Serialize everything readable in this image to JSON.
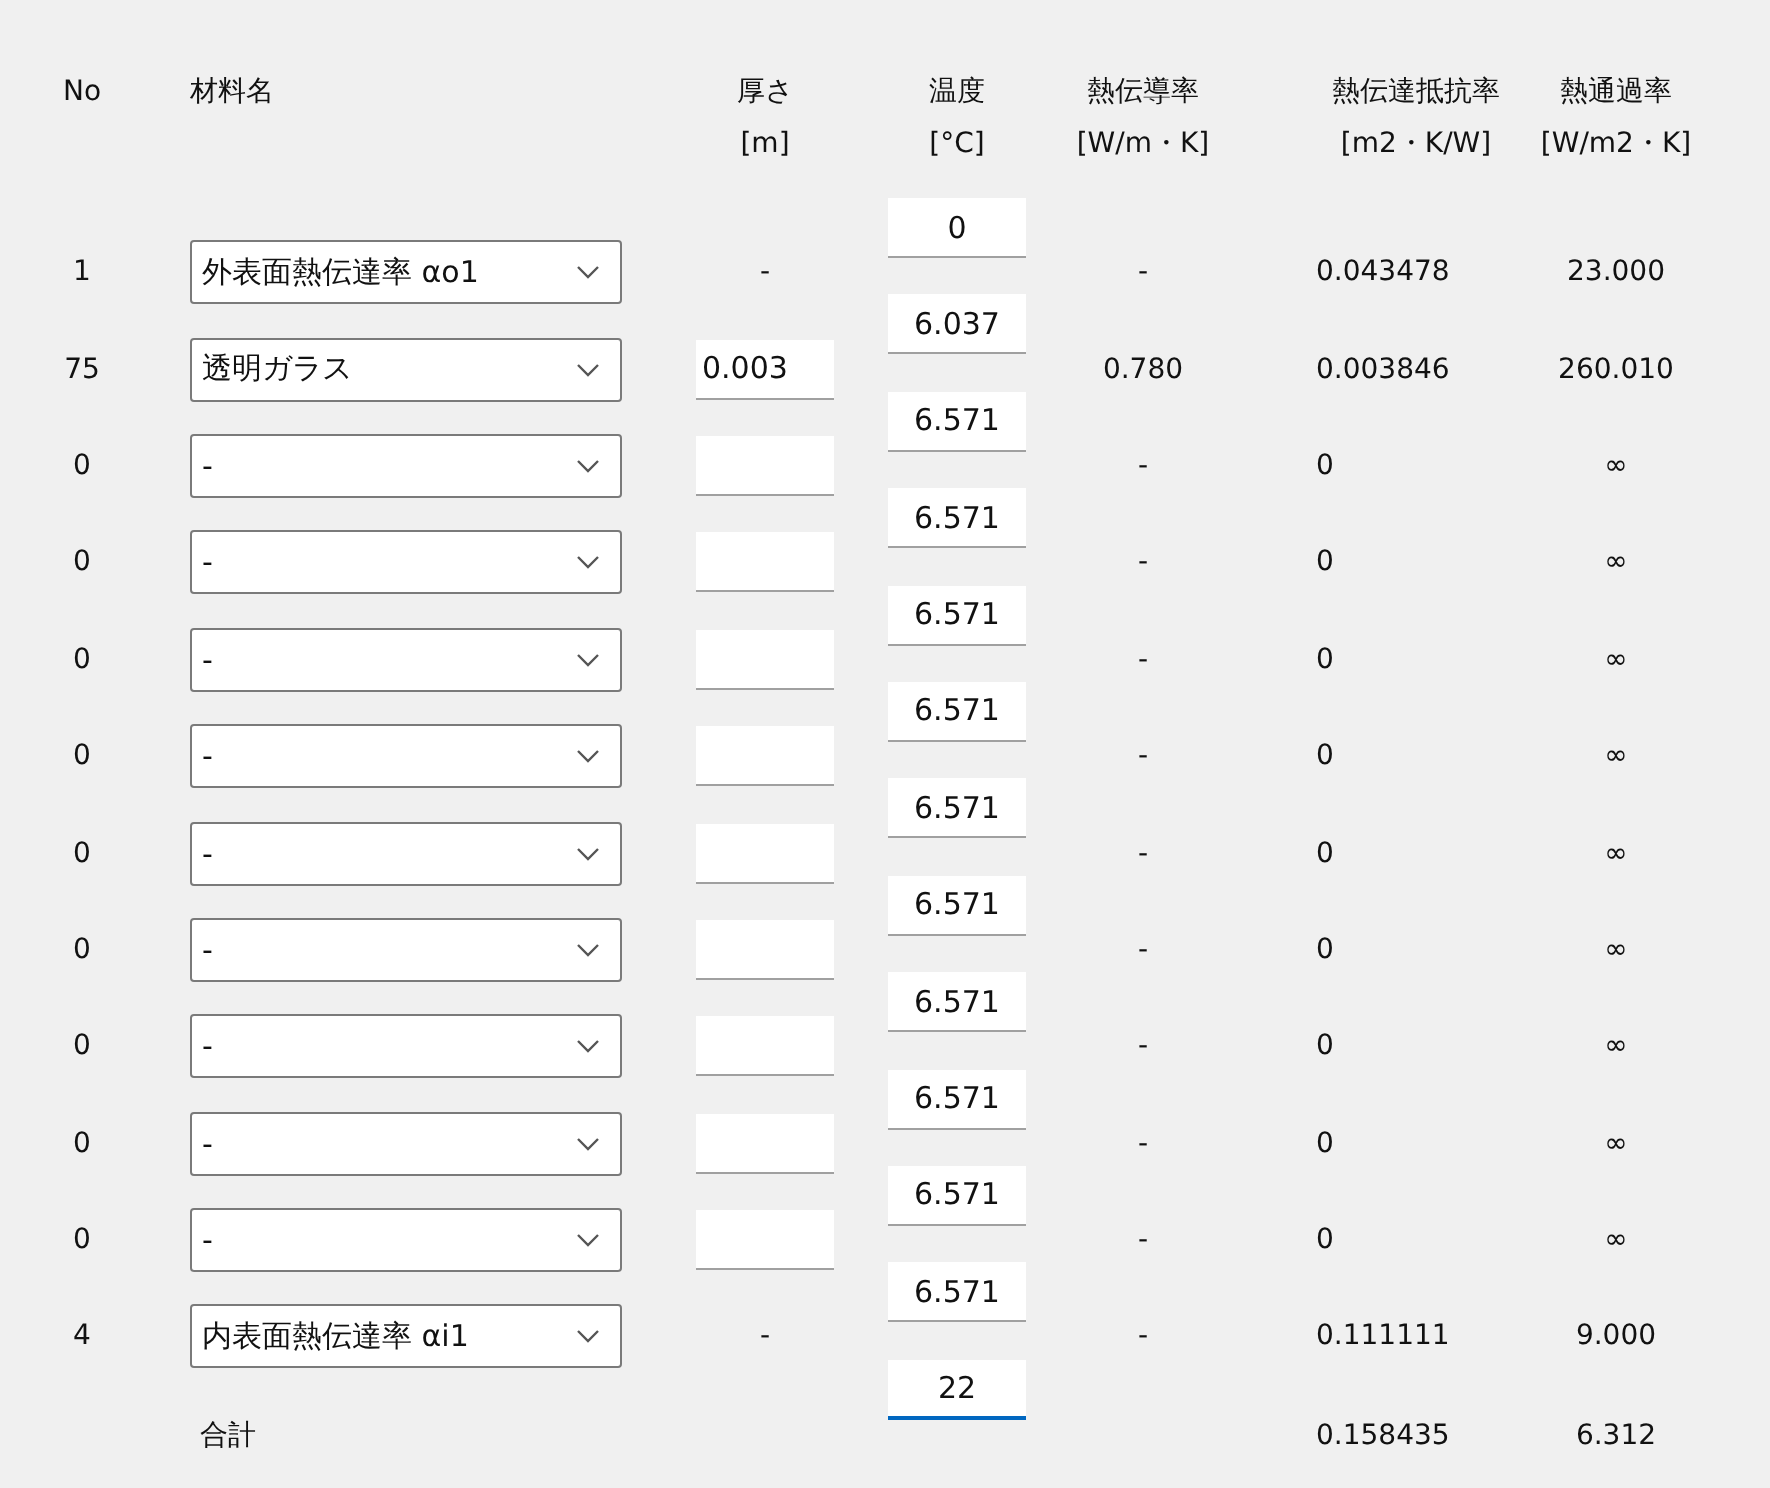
{
  "header": {
    "no": "No",
    "material": "材料名",
    "thickness": [
      "厚さ",
      "[m]"
    ],
    "temperature": [
      "温度",
      "[°C]"
    ],
    "conductivity": [
      "熱伝導率",
      "[W/m・K]"
    ],
    "resistance": [
      "熱伝達抵抗率",
      "[m2・K/W]"
    ],
    "transmittance": [
      "熱通過率",
      "[W/m2・K]"
    ]
  },
  "layers": [
    {
      "no": "1",
      "material": "外表面熱伝達率 αo1",
      "thickness": {
        "kind": "text",
        "value": "-"
      },
      "conductivity": "-",
      "resistance": "0.043478",
      "transmittance": "23.000"
    },
    {
      "no": "75",
      "material": "透明ガラス",
      "thickness": {
        "kind": "input",
        "value": "0.003"
      },
      "conductivity": "0.780",
      "resistance": "0.003846",
      "transmittance": "260.010"
    },
    {
      "no": "0",
      "material": "-",
      "thickness": {
        "kind": "input"
      },
      "conductivity": "-",
      "resistance": "0",
      "transmittance": "∞"
    },
    {
      "no": "0",
      "material": "-",
      "thickness": {
        "kind": "input"
      },
      "conductivity": "-",
      "resistance": "0",
      "transmittance": "∞"
    },
    {
      "no": "0",
      "material": "-",
      "thickness": {
        "kind": "input"
      },
      "conductivity": "-",
      "resistance": "0",
      "transmittance": "∞"
    },
    {
      "no": "0",
      "material": "-",
      "thickness": {
        "kind": "input"
      },
      "conductivity": "-",
      "resistance": "0",
      "transmittance": "∞"
    },
    {
      "no": "0",
      "material": "-",
      "thickness": {
        "kind": "input"
      },
      "conductivity": "-",
      "resistance": "0",
      "transmittance": "∞"
    },
    {
      "no": "0",
      "material": "-",
      "thickness": {
        "kind": "input"
      },
      "conductivity": "-",
      "resistance": "0",
      "transmittance": "∞"
    },
    {
      "no": "0",
      "material": "-",
      "thickness": {
        "kind": "input"
      },
      "conductivity": "-",
      "resistance": "0",
      "transmittance": "∞"
    },
    {
      "no": "0",
      "material": "-",
      "thickness": {
        "kind": "input"
      },
      "conductivity": "-",
      "resistance": "0",
      "transmittance": "∞"
    },
    {
      "no": "0",
      "material": "-",
      "thickness": {
        "kind": "input"
      },
      "conductivity": "-",
      "resistance": "0",
      "transmittance": "∞"
    },
    {
      "no": "4",
      "material": "内表面熱伝達率 αi1",
      "thickness": {
        "kind": "text",
        "value": "-"
      },
      "conductivity": "-",
      "resistance": "0.111111",
      "transmittance": "9.000"
    }
  ],
  "temperatures": [
    {
      "value": "0",
      "focused": false
    },
    {
      "value": "6.037",
      "focused": false
    },
    {
      "value": "6.571",
      "focused": false
    },
    {
      "value": "6.571",
      "focused": false
    },
    {
      "value": "6.571",
      "focused": false
    },
    {
      "value": "6.571",
      "focused": false
    },
    {
      "value": "6.571",
      "focused": false
    },
    {
      "value": "6.571",
      "focused": false
    },
    {
      "value": "6.571",
      "focused": false
    },
    {
      "value": "6.571",
      "focused": false
    },
    {
      "value": "6.571",
      "focused": false
    },
    {
      "value": "6.571",
      "focused": false
    },
    {
      "value": "22",
      "focused": true
    }
  ],
  "total": {
    "label": "合計",
    "resistance": "0.158435",
    "transmittance": "6.312"
  }
}
